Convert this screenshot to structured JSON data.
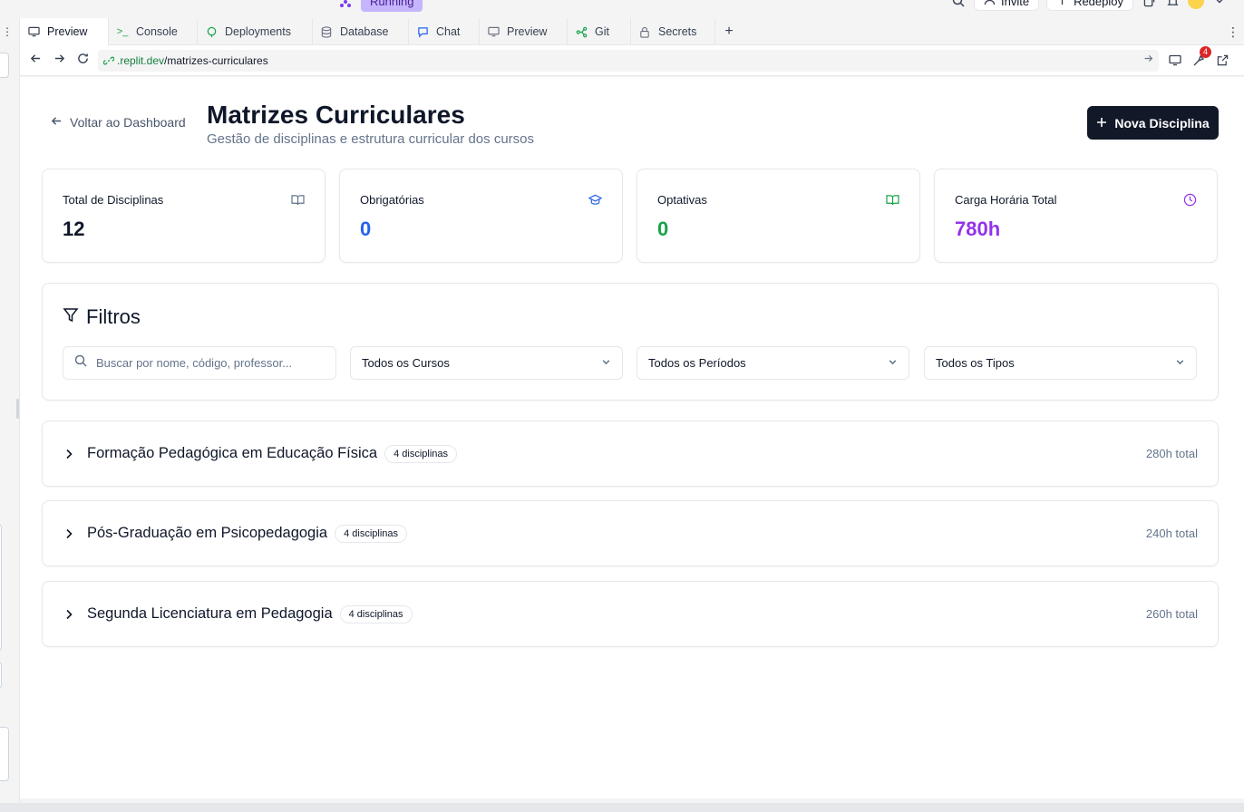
{
  "replit": {
    "status": "Running",
    "invite_label": "Invite",
    "redeploy_label": "Redeploy",
    "notification_count": "4"
  },
  "tabs": [
    {
      "label": "Preview",
      "icon": "monitor-icon",
      "active": true
    },
    {
      "label": "Console",
      "icon": "terminal-icon"
    },
    {
      "label": "Deployments",
      "icon": "deployments-icon"
    },
    {
      "label": "Database",
      "icon": "database-icon"
    },
    {
      "label": "Chat",
      "icon": "chat-icon"
    },
    {
      "label": "Preview",
      "icon": "monitor-icon"
    },
    {
      "label": "Git",
      "icon": "git-icon"
    },
    {
      "label": "Secrets",
      "icon": "lock-icon"
    }
  ],
  "url": {
    "domain": ".replit.dev",
    "path": "/matrizes-curriculares"
  },
  "page": {
    "back_label": "Voltar ao Dashboard",
    "title": "Matrizes Curriculares",
    "subtitle": "Gestão de disciplinas e estrutura curricular dos cursos",
    "new_button": "Nova Disciplina"
  },
  "stats": [
    {
      "label": "Total de Disciplinas",
      "value": "12",
      "color": "#0f172a",
      "icon": "book-open-icon",
      "icon_color": "#64748b"
    },
    {
      "label": "Obrigatórias",
      "value": "0",
      "color": "#2563eb",
      "icon": "graduation-cap-icon",
      "icon_color": "#2563eb"
    },
    {
      "label": "Optativas",
      "value": "0",
      "color": "#16a34a",
      "icon": "book-open-icon",
      "icon_color": "#16a34a"
    },
    {
      "label": "Carga Horária Total",
      "value": "780h",
      "color": "#9333ea",
      "icon": "clock-icon",
      "icon_color": "#9333ea"
    }
  ],
  "filters": {
    "title": "Filtros",
    "search_placeholder": "Buscar por nome, código, professor...",
    "course_select": "Todos os Cursos",
    "period_select": "Todos os Períodos",
    "type_select": "Todos os Tipos"
  },
  "courses": [
    {
      "name": "Formação Pedagógica em Educação Física",
      "count": "4 disciplinas",
      "hours": "280h total"
    },
    {
      "name": "Pós-Graduação em Psicopedagogia",
      "count": "4 disciplinas",
      "hours": "240h total"
    },
    {
      "name": "Segunda Licenciatura em Pedagogia",
      "count": "4 disciplinas",
      "hours": "260h total"
    }
  ]
}
